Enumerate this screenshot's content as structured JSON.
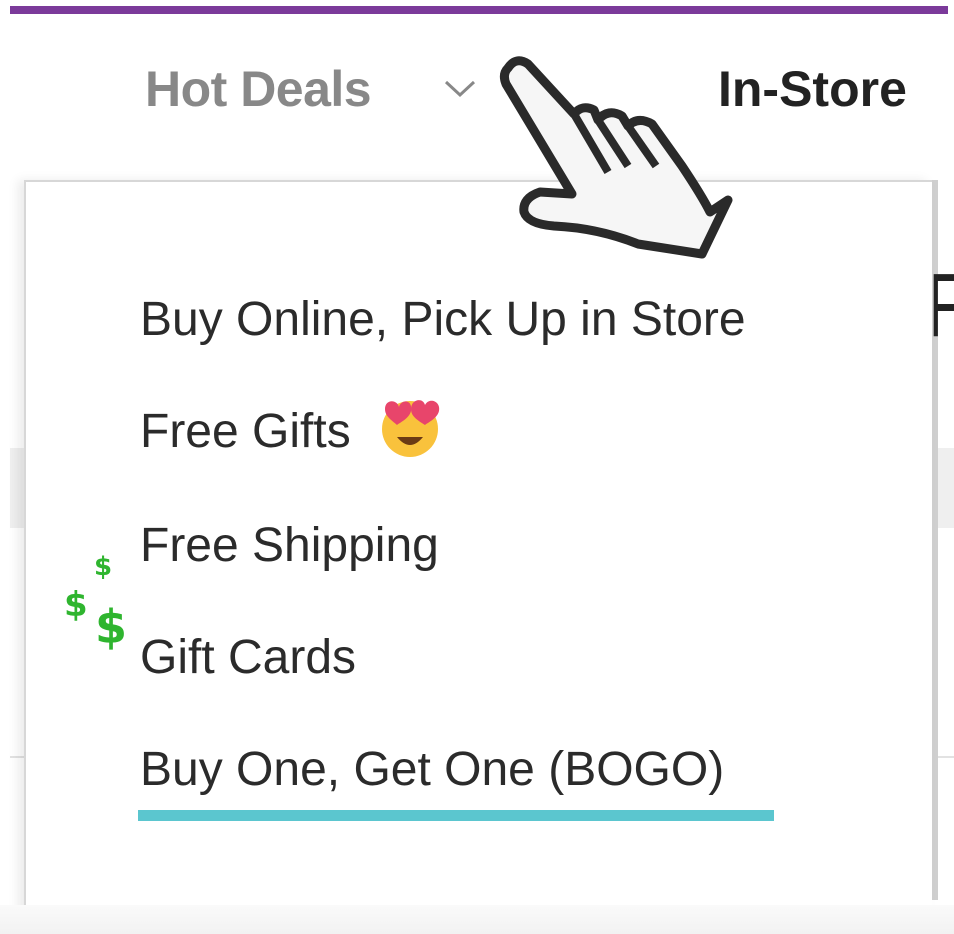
{
  "colors": {
    "accent": "#7b3a9a",
    "underline": "#5bc6cf",
    "muted": "#888888",
    "money": "#2fb52f"
  },
  "nav": {
    "hot_deals": "Hot Deals",
    "in_store": "In-Store",
    "chevron_icon": "chevron-down-icon"
  },
  "menu": {
    "items": [
      {
        "label": "Buy Online, Pick Up in Store"
      },
      {
        "label": "Free Gifts"
      },
      {
        "label": "Free Shipping"
      },
      {
        "label": "Gift Cards"
      },
      {
        "label": "Buy One, Get One (BOGO)"
      }
    ]
  },
  "decor": {
    "free_gifts_emoji": "heart-eyes-icon",
    "gift_cards_decor": "dollar-signs-icon",
    "pointer": "pointing-hand-cursor-icon",
    "dollar_glyph": "$"
  }
}
